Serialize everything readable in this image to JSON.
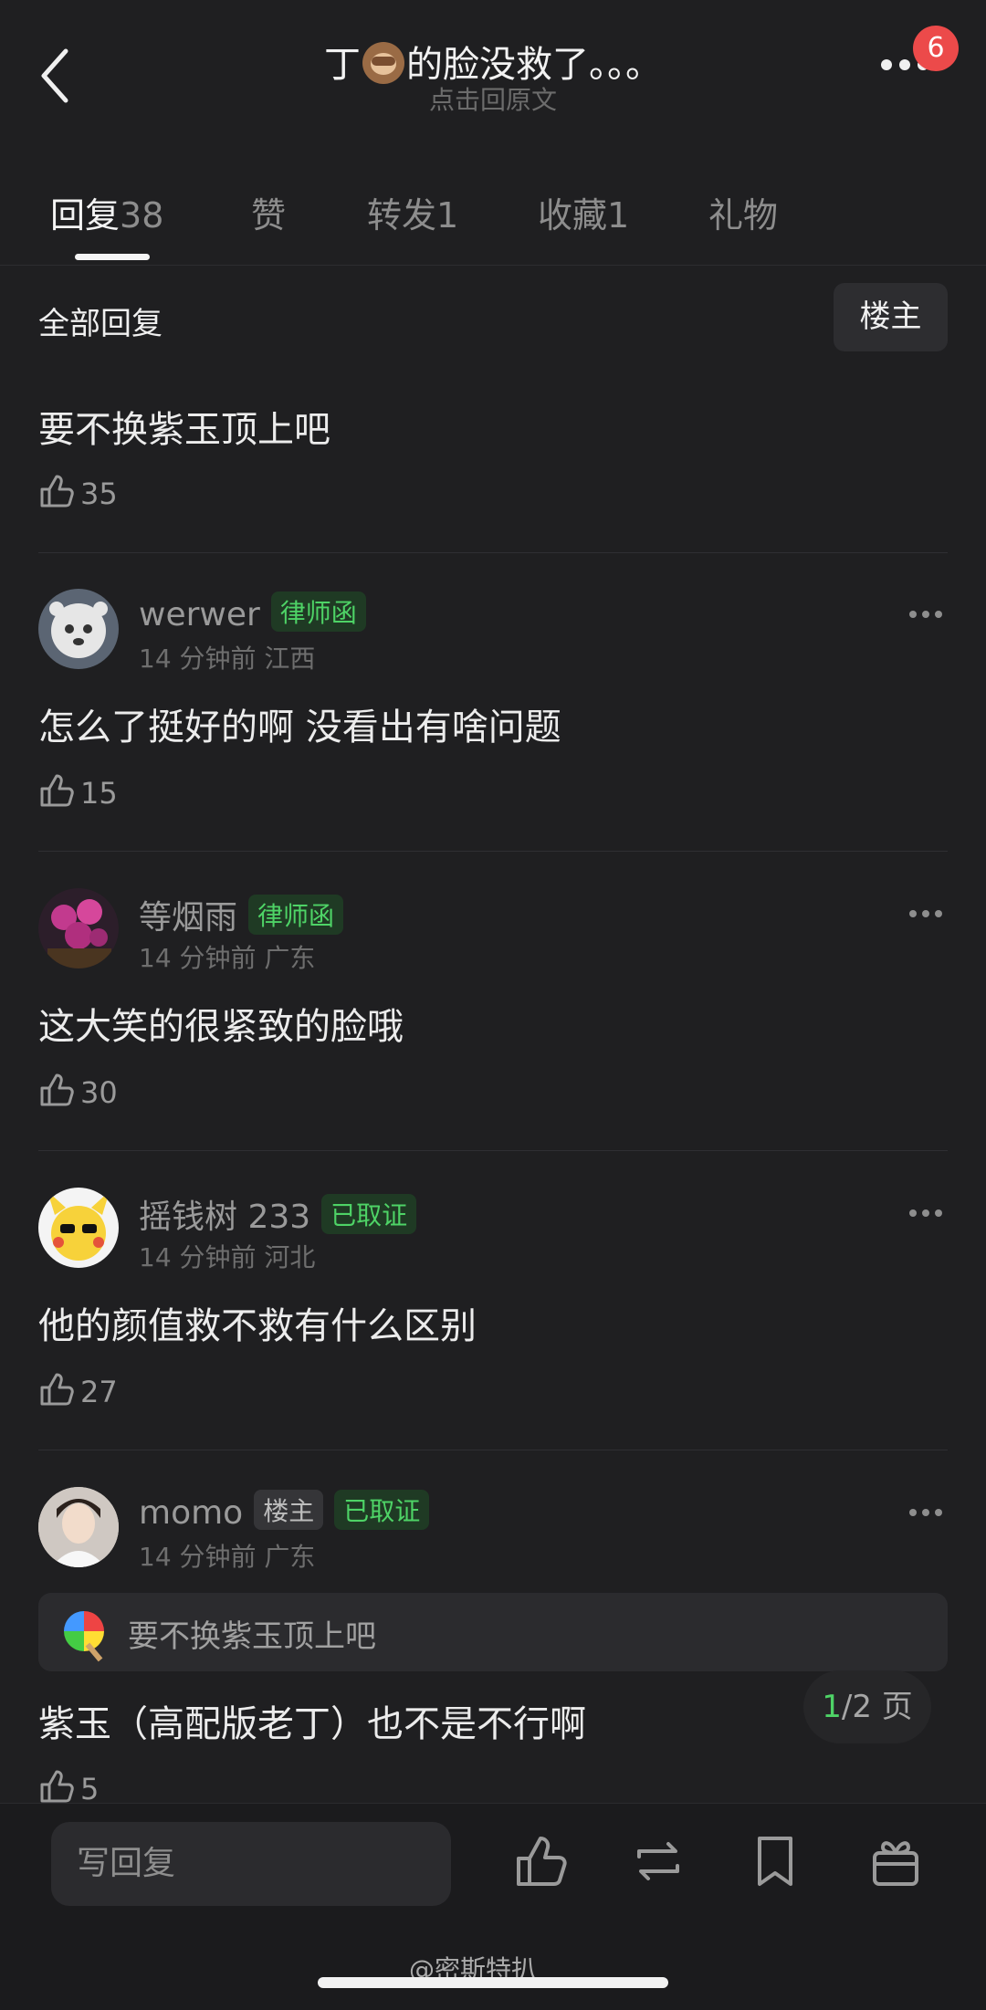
{
  "header": {
    "title_before": "丁",
    "title_after": "的脸没救了。。。",
    "emoji_icon": "see-no-evil-monkey",
    "subtitle": "点击回原文",
    "notification_count": "6"
  },
  "tabs": [
    {
      "label": "回复",
      "count": "38",
      "active": true
    },
    {
      "label": "赞",
      "count": ""
    },
    {
      "label": "转发",
      "count": "1"
    },
    {
      "label": "收藏",
      "count": "1"
    },
    {
      "label": "礼物",
      "count": ""
    }
  ],
  "section": {
    "title": "全部回复",
    "owner_filter": "楼主"
  },
  "top_comment": {
    "text": "要不换紫玉顶上吧",
    "likes": "35"
  },
  "comments": [
    {
      "user": "werwer",
      "tags": [
        "律师函"
      ],
      "meta": "14 分钟前 江西",
      "text": "怎么了挺好的啊 没看出有啥问题",
      "likes": "15"
    },
    {
      "user": "等烟雨",
      "tags": [
        "律师函"
      ],
      "meta": "14 分钟前 广东",
      "text": "这大笑的很紧致的脸哦",
      "likes": "30"
    },
    {
      "user": "摇钱树 233",
      "tags": [
        "已取证"
      ],
      "meta": "14 分钟前 河北",
      "text": "他的颜值救不救有什么区别",
      "likes": "27"
    },
    {
      "user": "momo",
      "tags": [
        "楼主",
        "已取证"
      ],
      "meta": "14 分钟前 广东",
      "quote": "要不换紫玉顶上吧",
      "text": "紫玉（高配版老丁）也不是不行啊",
      "likes": "5"
    }
  ],
  "pager": {
    "current": "1",
    "total": "/2 页"
  },
  "bottom_bar": {
    "reply_placeholder": "写回复"
  },
  "watermark": "@密斯特扒",
  "colors": {
    "background": "#1f1f21",
    "accent_green": "#4ed366",
    "badge_red": "#ec4a4a"
  }
}
